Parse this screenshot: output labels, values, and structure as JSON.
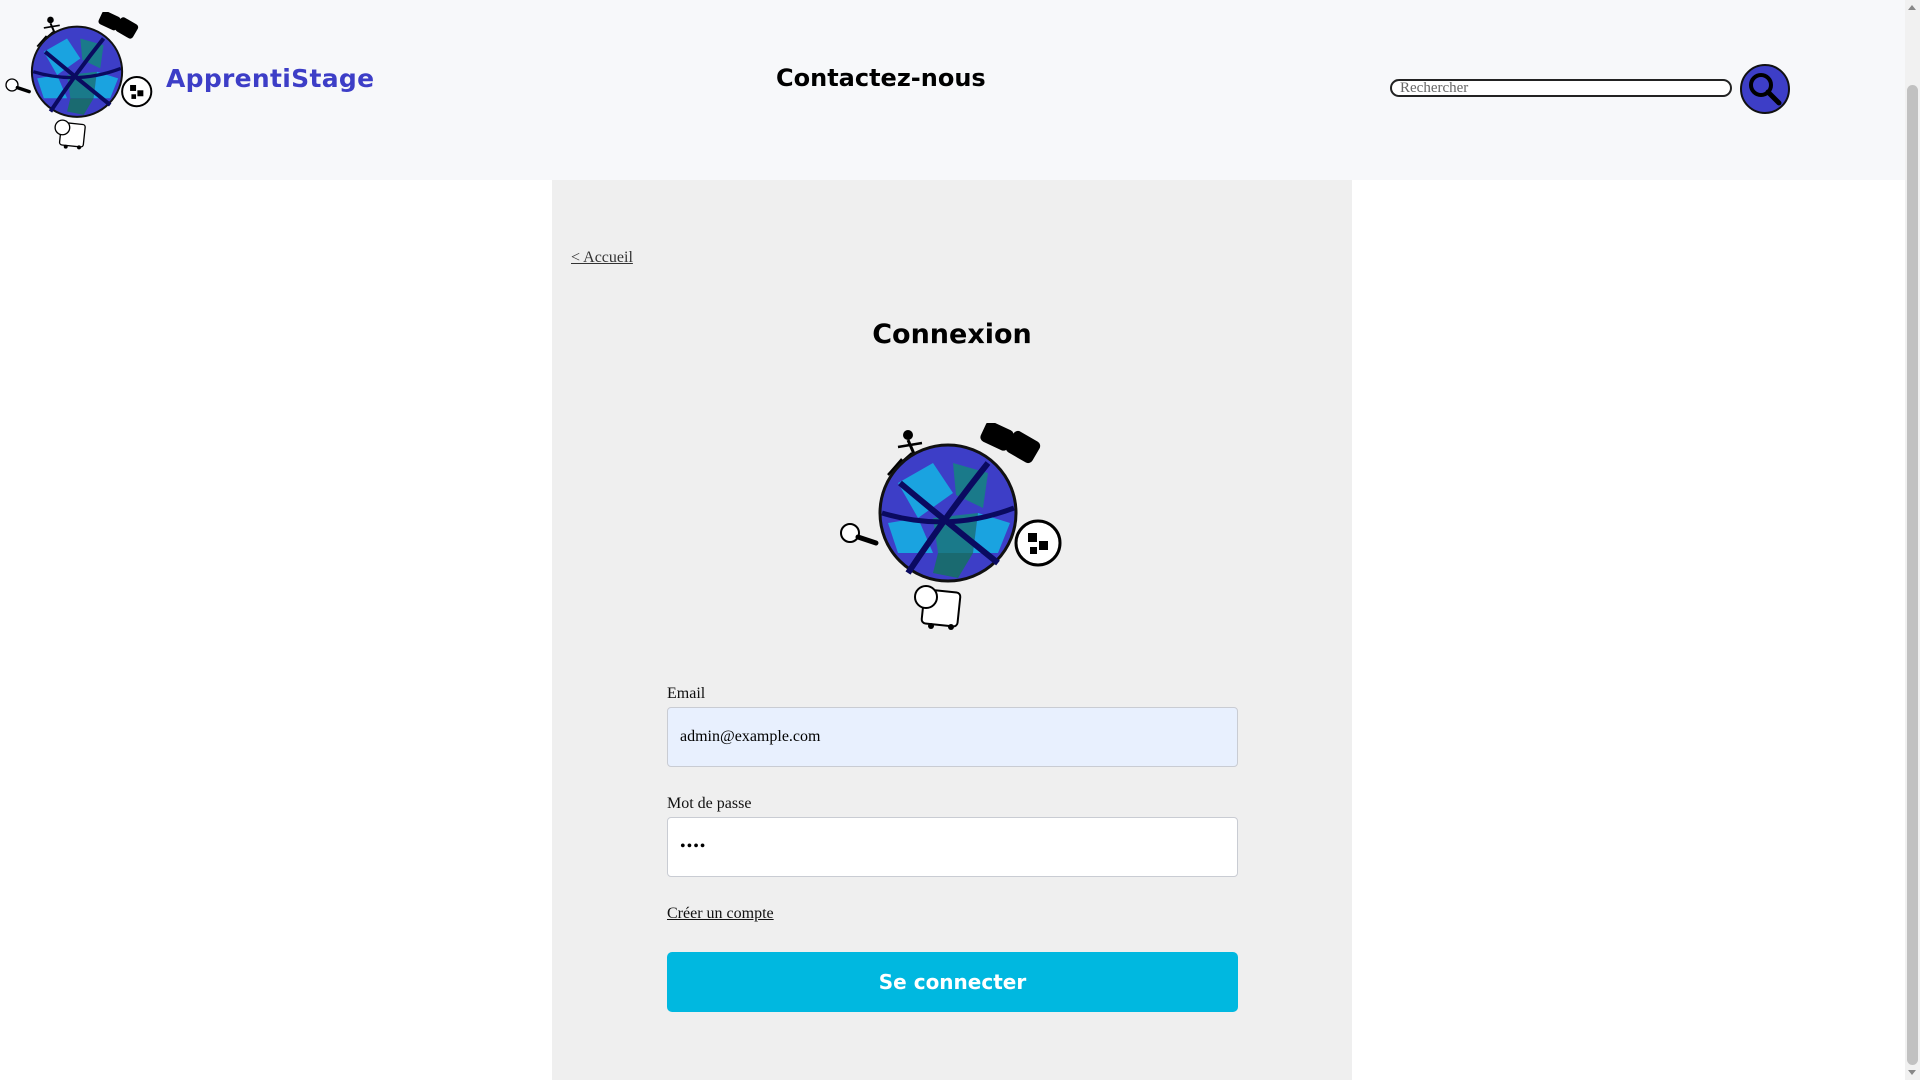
{
  "header": {
    "brand": "ApprentiStage",
    "contact_label": "Contactez-nous",
    "search": {
      "placeholder": "Rechercher",
      "value": ""
    }
  },
  "main": {
    "back_link": "< Accueil",
    "title": "Connexion",
    "form": {
      "email_label": "Email",
      "email_value": "admin@example.com",
      "password_label": "Mot de passe",
      "password_value": "••••",
      "create_account_link": "Créer un compte",
      "submit_label": "Se connecter"
    }
  },
  "colors": {
    "brand": "#3d3ec7",
    "button": "#00b8e0",
    "header_bg": "#f7f8fa",
    "panel_bg": "#efefef",
    "autofill_bg": "#e8f0fe"
  },
  "icons": {
    "logo": "globe-logo-icon",
    "search": "search-icon"
  }
}
